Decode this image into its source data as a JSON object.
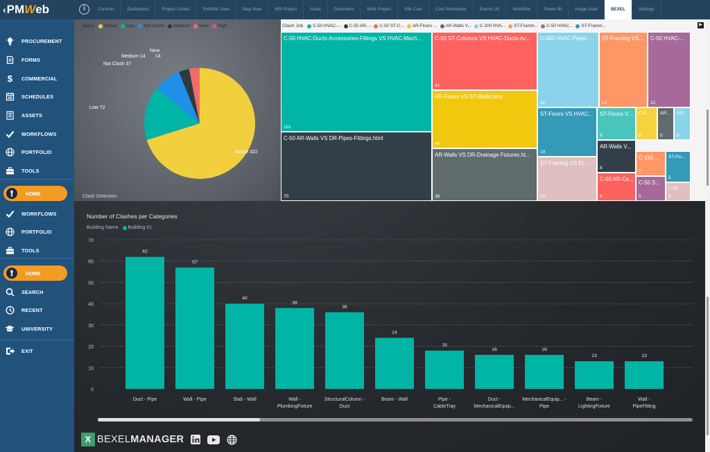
{
  "logo": {
    "prefix": "PM",
    "accent": "W",
    "suffix": "eb"
  },
  "tabs": [
    "Controls",
    "Dashboard",
    "Project Center",
    "Portfolio View",
    "Map View",
    "WS Project",
    "Asset",
    "Document",
    "Multi Project",
    "Site Cam",
    "Cost Worksheet",
    "Events (4)",
    "Workflow",
    "Power-BI",
    "Image Gate",
    "BEXEL",
    "Settings"
  ],
  "active_tab": "BEXEL",
  "sidebar": {
    "items": [
      {
        "label": "PROCUREMENT",
        "icon": "lightbulb-icon"
      },
      {
        "label": "FORMS",
        "icon": "forms-icon"
      },
      {
        "label": "COMMERCIAL",
        "icon": "dollar-icon"
      },
      {
        "label": "SCHEDULES",
        "icon": "schedule-icon"
      },
      {
        "label": "ASSETS",
        "icon": "assets-icon"
      },
      {
        "label": "WORKFLOWS",
        "icon": "check-icon"
      },
      {
        "label": "PORTFOLIO",
        "icon": "globe-icon"
      },
      {
        "label": "TOOLS",
        "icon": "toolbox-icon"
      }
    ],
    "home1": "HOME",
    "items2": [
      {
        "label": "WORKFLOWS",
        "icon": "check-icon"
      },
      {
        "label": "PORTFOLIO",
        "icon": "globe-icon"
      },
      {
        "label": "TOOLS",
        "icon": "toolbox-icon"
      }
    ],
    "home2": "HOME",
    "items3": [
      {
        "label": "SEARCH",
        "icon": "search-icon"
      },
      {
        "label": "RECENT",
        "icon": "clock-icon"
      },
      {
        "label": "UNIVERSITY",
        "icon": "graduation-cap-icon"
      }
    ],
    "exit": "EXIT"
  },
  "pie": {
    "legend_title": "status",
    "legend": [
      {
        "name": "Active",
        "color": "#f2cf3d"
      },
      {
        "name": "Low",
        "color": "#00b5a5"
      },
      {
        "name": "Not Clash",
        "color": "#1f8fe8"
      },
      {
        "name": "Medium",
        "color": "#2e3a42"
      },
      {
        "name": "New",
        "color": "#f46a6a"
      },
      {
        "name": "High",
        "color": "#e85078"
      }
    ],
    "footer": "Clash Detection"
  },
  "treemap": {
    "legend_title": "Clash Job",
    "legend": [
      {
        "name": "C-50 HVAC-...",
        "color": "#00b5a5"
      },
      {
        "name": "C-50 AR-...",
        "color": "#333f48"
      },
      {
        "name": "C-50 ST-C...",
        "color": "#fd625e"
      },
      {
        "name": "AR-Floors ...",
        "color": "#f2c80f"
      },
      {
        "name": "AR-Walls V...",
        "color": "#5f6b6d"
      },
      {
        "name": "C-300 HVA...",
        "color": "#8ad4eb"
      },
      {
        "name": "ST-Framin...",
        "color": "#fe9666"
      },
      {
        "name": "C-50 HVAC...",
        "color": "#a66999"
      },
      {
        "name": "ST-Framin...",
        "color": "#3599b8"
      }
    ]
  },
  "bar": {
    "title": "Number of Clashes per Categories",
    "legend_title": "Building Name",
    "legend_item": "Building 01",
    "legend_color": "#00b5a5"
  },
  "brand": {
    "mark": "X",
    "name1": "BEXEL",
    "name2": "MANAGER"
  },
  "chart_data": [
    {
      "type": "pie",
      "labels": [
        "Active",
        "Low",
        "Not Clash",
        "Medium",
        "New",
        "High"
      ],
      "values": [
        322,
        72,
        37,
        14,
        14,
        0
      ],
      "colors": [
        "#f2cf3d",
        "#00b5a5",
        "#1f8fe8",
        "#2e3a42",
        "#f46a6a",
        "#e85078"
      ],
      "data_labels": [
        "Active 322",
        "Low 72",
        "Not Clash 37",
        "Medium 14",
        "New",
        "14"
      ],
      "legend": "top"
    },
    {
      "type": "table",
      "subtype": "treemap",
      "cells": [
        {
          "name": "C-50 HVAC-Ducts-Accessories-Fittings VS HVAC-Mech...",
          "value": 101,
          "color": "#00b5a5"
        },
        {
          "name": "C-50 AR-Walls VS DR-Pipes-Fittings.html",
          "value": 70,
          "color": "#333f48"
        },
        {
          "name": "C-50 ST-Columns VS HVAC-Ducts-Ac...",
          "value": 41,
          "color": "#fd625e"
        },
        {
          "name": "AR-Floors VS ST-Walls.html",
          "value": 40,
          "color": "#f2c80f"
        },
        {
          "name": "AR-Walls VS DR-Drainage Fixtures.ht...",
          "value": 38,
          "color": "#5f6b6d"
        },
        {
          "name": "C-300 HVAC-Pipes-...",
          "value": 31,
          "color": "#8ad4eb"
        },
        {
          "name": "ST-Framing VS HV...",
          "value": 24,
          "color": "#fe9666"
        },
        {
          "name": "C-50 HVAC-...",
          "value": 22,
          "color": "#a66999"
        },
        {
          "name": "ST-Floors VS HVAC...",
          "value": 19,
          "color": "#3599b8"
        },
        {
          "name": "ST-Framing VS EL-...",
          "value": 18,
          "color": "#dfbfbf"
        },
        {
          "name": "ST-Floors V...",
          "value": 9,
          "color": "#4ac5bb"
        },
        {
          "name": "C-5...",
          "value": 8,
          "color": "#f5d33f"
        },
        {
          "name": "AR...",
          "value": 5,
          "color": "#5f6b6d"
        },
        {
          "name": "AR...",
          "value": 5,
          "color": "#8ad4eb"
        },
        {
          "name": "AR-Walls V...",
          "value": 8,
          "color": "#333f48"
        },
        {
          "name": "C-150 ...",
          "value": 7,
          "color": "#fe9666"
        },
        {
          "name": "C-50 AR-Ce...",
          "value": 8,
          "color": "#fd625e"
        },
        {
          "name": "ST-Flo...",
          "value": 5,
          "color": "#3599b8"
        },
        {
          "name": "C-50 S...",
          "value": 5,
          "color": "#a66999"
        },
        {
          "name": "C-50 ...",
          "value": 4,
          "color": "#dfbfbf"
        }
      ]
    },
    {
      "type": "bar",
      "categories": [
        "Duct - Pipe",
        "Wall - Pipe",
        "Slab - Wall",
        "Wall - PlumbingFixture",
        "StructuralColumn - Duct",
        "Beam - Wall",
        "Pipe - CableTray",
        "Duct - MechanicalEquip...",
        "MechanicalEquip... - Pipe",
        "Beam - LightingFixture",
        "Wall - PipeFitting"
      ],
      "values": [
        62,
        57,
        40,
        38,
        36,
        24,
        18,
        16,
        16,
        13,
        13
      ],
      "yticks": [
        0,
        10,
        20,
        30,
        40,
        50,
        60,
        70
      ],
      "ylim": [
        0,
        70
      ],
      "series": [
        {
          "name": "Building 01",
          "values": [
            62,
            57,
            40,
            38,
            36,
            24,
            18,
            16,
            16,
            13,
            13
          ]
        }
      ],
      "color": "#00b5a5",
      "grid": true,
      "legend": "top-left"
    }
  ]
}
